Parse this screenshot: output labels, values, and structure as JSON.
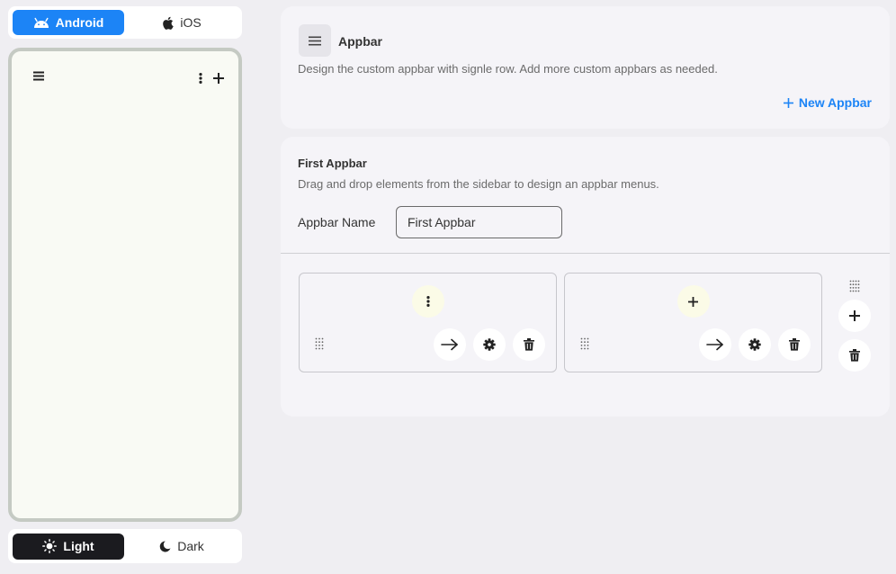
{
  "platform": {
    "android_label": "Android",
    "ios_label": "iOS",
    "selected": "Android"
  },
  "theme": {
    "light_label": "Light",
    "dark_label": "Dark",
    "selected": "Light"
  },
  "header": {
    "title": "Appbar",
    "description": "Design the custom appbar with signle row. Add more custom appbars as needed.",
    "new_button_label": "New Appbar"
  },
  "editor": {
    "title": "First Appbar",
    "description": "Drag and drop elements from the sidebar to design an appbar menus.",
    "name_label": "Appbar Name",
    "name_value": "First Appbar"
  },
  "menu_items": [
    {
      "icon": "more-vertical-icon"
    },
    {
      "icon": "plus-icon"
    }
  ],
  "colors": {
    "accent": "#1c84f6",
    "dark": "#1b1b1f",
    "panel": "#f5f4f8",
    "page": "#efeef2",
    "phone_frame": "#c5cac3",
    "phone_screen": "#f9faf4"
  }
}
